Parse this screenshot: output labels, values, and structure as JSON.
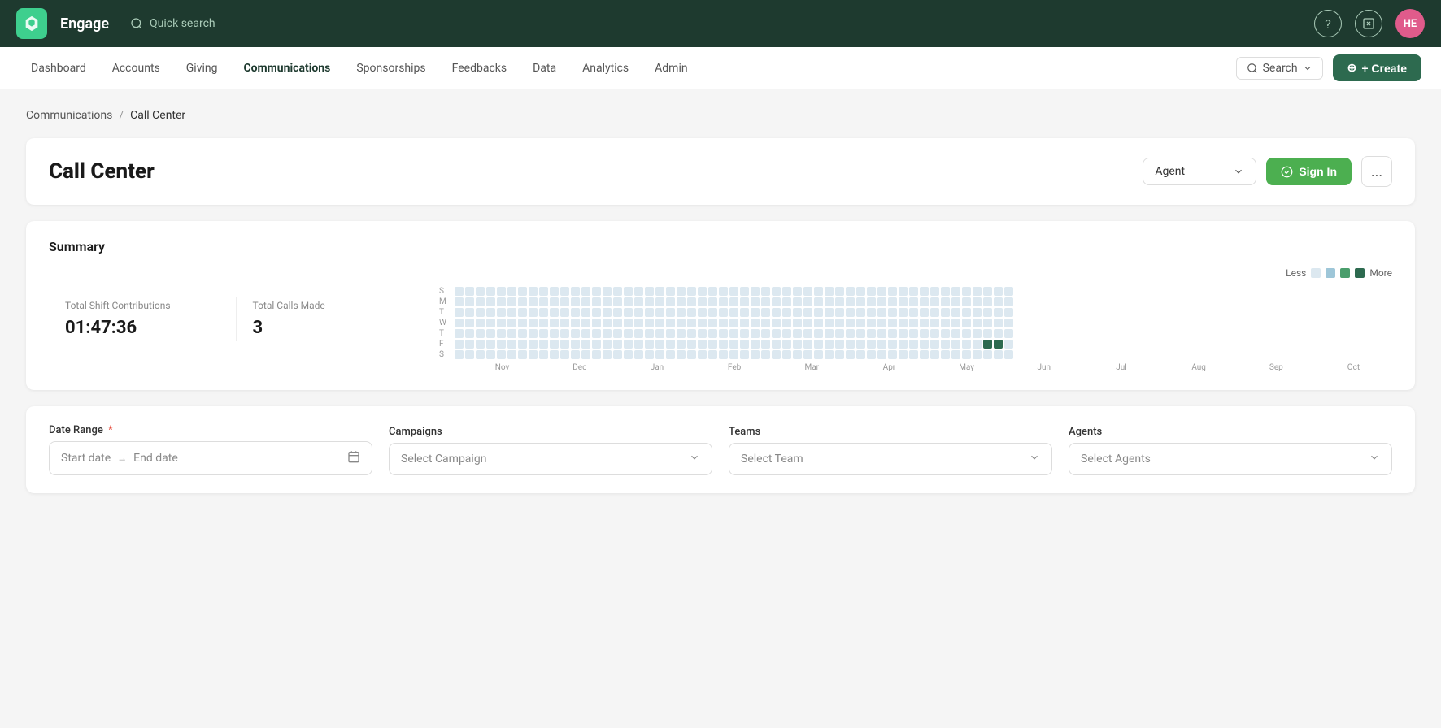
{
  "app": {
    "name": "Engage"
  },
  "topnav": {
    "quick_search_placeholder": "Quick search",
    "avatar_initials": "HE"
  },
  "secondarynav": {
    "items": [
      {
        "label": "Dashboard",
        "active": false
      },
      {
        "label": "Accounts",
        "active": false
      },
      {
        "label": "Giving",
        "active": false
      },
      {
        "label": "Communications",
        "active": true
      },
      {
        "label": "Sponsorships",
        "active": false
      },
      {
        "label": "Feedbacks",
        "active": false
      },
      {
        "label": "Data",
        "active": false
      },
      {
        "label": "Analytics",
        "active": false
      },
      {
        "label": "Admin",
        "active": false
      }
    ],
    "search_label": "Search",
    "create_label": "+ Create"
  },
  "breadcrumb": {
    "parent": "Communications",
    "separator": "/",
    "current": "Call Center"
  },
  "page": {
    "title": "Call Center",
    "agent_dropdown_label": "Agent",
    "sign_in_label": "Sign In",
    "more_label": "..."
  },
  "summary": {
    "title": "Summary",
    "total_shift_contributions_label": "Total Shift Contributions",
    "total_shift_contributions_value": "01:47:36",
    "total_calls_made_label": "Total Calls Made",
    "total_calls_made_value": "3",
    "legend": {
      "less_label": "Less",
      "more_label": "More"
    },
    "months": [
      "Nov",
      "Dec",
      "Jan",
      "Feb",
      "Mar",
      "Apr",
      "May",
      "Jun",
      "Jul",
      "Aug",
      "Sep",
      "Oct"
    ],
    "days": [
      "S",
      "M",
      "T",
      "W",
      "T",
      "F",
      "S"
    ]
  },
  "filters": {
    "date_range_label": "Date Range",
    "date_range_required": true,
    "start_date_placeholder": "Start date",
    "end_date_placeholder": "End date",
    "campaigns_label": "Campaigns",
    "campaigns_placeholder": "Select Campaign",
    "teams_label": "Teams",
    "teams_placeholder": "Select Team",
    "agents_label": "Agents",
    "agents_placeholder": "Select Agents"
  }
}
